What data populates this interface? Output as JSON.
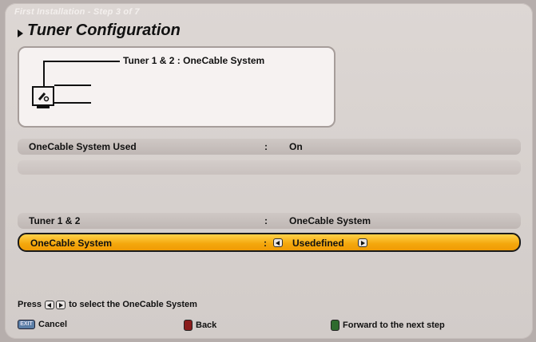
{
  "header": {
    "step": "First Installation - Step 3 of 7",
    "title": "Tuner Configuration"
  },
  "diagram": {
    "label": "Tuner 1 & 2 : OneCable System"
  },
  "settings": {
    "rows": [
      {
        "label": "OneCable System Used",
        "value": "On"
      },
      {
        "label": "",
        "value": ""
      },
      {
        "label": "Tuner 1 & 2",
        "value": "OneCable System"
      },
      {
        "label": "OneCable System",
        "value": "Usedefined"
      }
    ],
    "colon": ":"
  },
  "hint": {
    "prefix": "Press",
    "suffix": "to select the OneCable System"
  },
  "footer": {
    "cancel": "Cancel",
    "back": "Back",
    "forward": "Forward to the next step"
  },
  "colors": {
    "selected": "#f4a70c",
    "background": "#d6d0cd"
  },
  "icons": [
    "chevron-right-icon",
    "tv-icon",
    "left-arrow-key-icon",
    "right-arrow-key-icon",
    "exit-key-icon",
    "red-key-icon",
    "green-key-icon"
  ]
}
